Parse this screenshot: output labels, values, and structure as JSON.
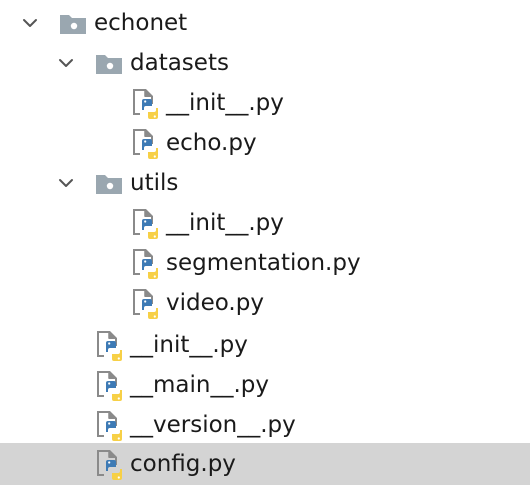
{
  "tree": {
    "root": {
      "label": "echonet",
      "expanded": true,
      "icon": "folder-icon"
    },
    "datasets": {
      "label": "datasets",
      "expanded": true,
      "icon": "folder-icon",
      "files": [
        {
          "label": "__init__.py",
          "icon": "python-file-icon"
        },
        {
          "label": "echo.py",
          "icon": "python-file-icon"
        }
      ]
    },
    "utils": {
      "label": "utils",
      "expanded": true,
      "icon": "folder-icon",
      "files": [
        {
          "label": "__init__.py",
          "icon": "python-file-icon"
        },
        {
          "label": "segmentation.py",
          "icon": "python-file-icon"
        },
        {
          "label": "video.py",
          "icon": "python-file-icon"
        }
      ]
    },
    "root_files": [
      {
        "label": "__init__.py",
        "icon": "python-file-icon",
        "selected": false
      },
      {
        "label": "__main__.py",
        "icon": "python-file-icon",
        "selected": false
      },
      {
        "label": "__version__.py",
        "icon": "python-file-icon",
        "selected": false
      },
      {
        "label": "config.py",
        "icon": "python-file-icon",
        "selected": true
      }
    ]
  },
  "colors": {
    "selection": "#d4d4d4",
    "folder": "#9aa7b0",
    "python_blue": "#3d7ab5",
    "python_yellow": "#f7d046",
    "page_gray": "#8a8a8a",
    "text": "#1a1a1a"
  }
}
